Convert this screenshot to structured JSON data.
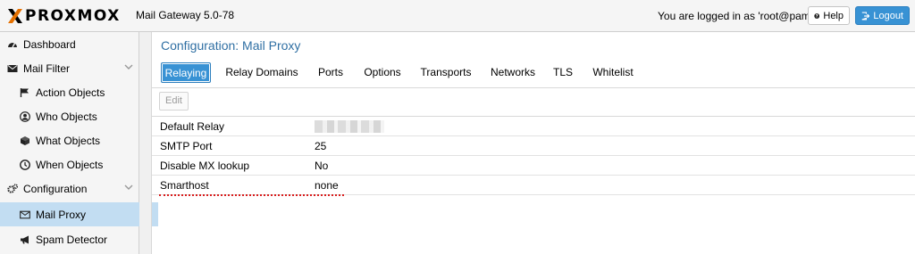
{
  "header": {
    "brand": "PROXMOX",
    "version": "Mail Gateway 5.0-78",
    "logged_in_text": "You are logged in as 'root@pam'",
    "help_label": "Help",
    "logout_label": "Logout",
    "colors": {
      "logo_x_orange": "#e57000",
      "logout_blue": "#3892d4"
    }
  },
  "sidebar": {
    "items": [
      {
        "label": "Dashboard",
        "icon": "dashboard-icon"
      },
      {
        "label": "Mail Filter",
        "icon": "envelope-icon"
      },
      {
        "label": "Action Objects",
        "icon": "flag-icon"
      },
      {
        "label": "Who Objects",
        "icon": "user-icon"
      },
      {
        "label": "What Objects",
        "icon": "cube-icon"
      },
      {
        "label": "When Objects",
        "icon": "clock-icon"
      },
      {
        "label": "Configuration",
        "icon": "gears-icon"
      },
      {
        "label": "Mail Proxy",
        "icon": "envelope-icon"
      },
      {
        "label": "Spam Detector",
        "icon": "bullhorn-icon"
      }
    ],
    "selected": "Mail Proxy",
    "selected_color": "#c2ddf2"
  },
  "main": {
    "title": "Configuration: Mail Proxy",
    "tabs": [
      {
        "label": "Relaying"
      },
      {
        "label": "Relay Domains"
      },
      {
        "label": "Ports"
      },
      {
        "label": "Options"
      },
      {
        "label": "Transports"
      },
      {
        "label": "Networks"
      },
      {
        "label": "TLS"
      },
      {
        "label": "Whitelist"
      }
    ],
    "active_tab": "Relaying",
    "edit_label": "Edit",
    "rows": [
      {
        "key": "Default Relay",
        "value": ""
      },
      {
        "key": "SMTP Port",
        "value": "25"
      },
      {
        "key": "Disable MX lookup",
        "value": "No"
      },
      {
        "key": "Smarthost",
        "value": "none"
      }
    ]
  }
}
